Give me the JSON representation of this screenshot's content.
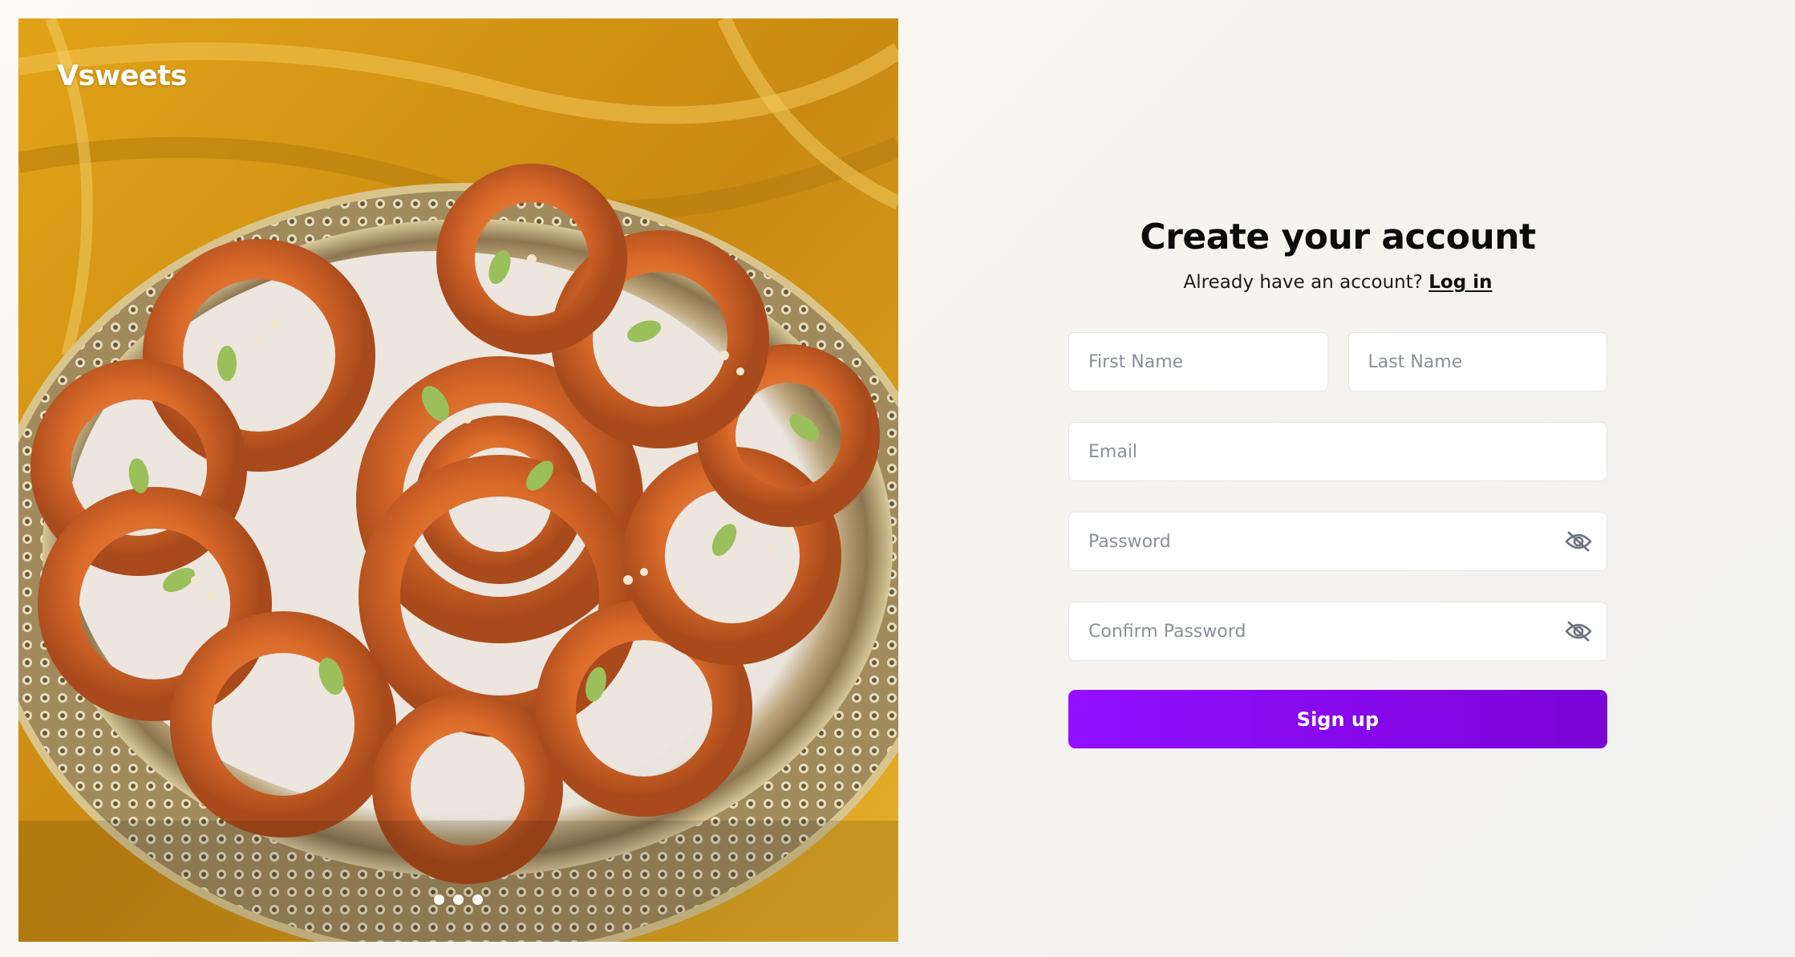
{
  "brand": {
    "name": "Vsweets"
  },
  "hero": {
    "carousel_dot_count": 3
  },
  "form": {
    "title": "Create your account",
    "login_prompt": "Already have an account?",
    "login_link": "Log in",
    "first_name": {
      "placeholder": "First Name",
      "value": ""
    },
    "last_name": {
      "placeholder": "Last Name",
      "value": ""
    },
    "email": {
      "placeholder": "Email",
      "value": ""
    },
    "password": {
      "placeholder": "Password",
      "value": ""
    },
    "confirm_password": {
      "placeholder": "Confirm Password",
      "value": ""
    },
    "submit_label": "Sign up"
  },
  "icons": {
    "password_toggle": "eye-off-icon",
    "confirm_password_toggle": "eye-off-icon"
  },
  "colors": {
    "accent": "#8a0cf0",
    "page_background": "#f8f6f0",
    "brand_text": "#ffffff"
  }
}
